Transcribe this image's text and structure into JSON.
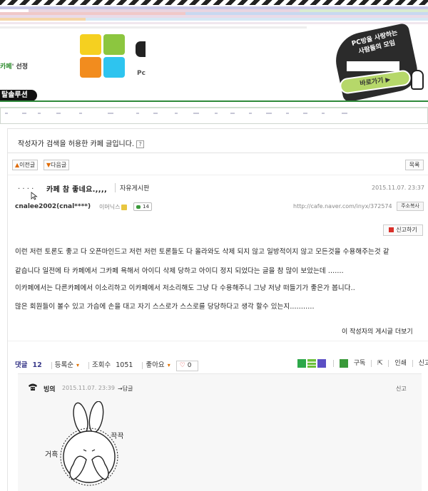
{
  "banner": {
    "brand_suffix": "카페",
    "brand_tail": "' 선정",
    "logo_fragment": "Pc",
    "promo_line1": "PC방을 사랑하는",
    "promo_line2": "사람들의 모임",
    "promo_button": "바로가기 ▶",
    "solution_label": "탈솔루션",
    "tile_colors": [
      "#f5d020",
      "#8cc63f",
      "#f28c1e",
      "#2ec4ef"
    ]
  },
  "article": {
    "notice": "작성자가 검색을 허용한 카페 글입니다.",
    "help_label": "?",
    "prev_label": "이전글",
    "next_label": "다음글",
    "list_label": "목록",
    "title_prefix": ". . . .",
    "title": "카페 참 좋네요.,,,,",
    "board": "자유게시판",
    "date": "2015.11.07. 23:37",
    "author": "cnalee2002(cnal****)",
    "grade": "이머닉스",
    "comment_badge": "14",
    "url": "http://cafe.naver.com/inyx/372574",
    "copy_label": "주소복사",
    "report_label": "신고하기",
    "paragraphs": [
      "이런 저런 토론도 좋고 다 오픈마인드고 저런 저런 토론들도 다 올라와도 삭제 되지 않고 일방적이지 않고 모든것을 수용해주는것 같",
      "같습니다 일전에 타 카페에서 그카페 욕해서 아이디 삭제 당하고 아이디 정지 되었다는 글을 참 많이 보았는데 .......",
      "이카페에서는 다른카페에서 이소리하고 이카페에서 저소리해도 그냥 다 수용해주니  그냥 저냥 떠들기가 좋은가 봅니다..",
      "많은 회원들이 볼수 있고 가슴에 손을 대고 자기 스스로가 스스로를 당당하다고 생각 할수 있는지..........."
    ],
    "more_posts": "이 작성자의 게시글 더보기"
  },
  "toolbar": {
    "comments_label": "댓글",
    "comments_count": "12",
    "sort_label": "등록순",
    "views_label": "조회수",
    "views_count": "1051",
    "like_label": "좋아요",
    "like_count": "0",
    "subscribe": "구독",
    "print": "인쇄",
    "report": "신고"
  },
  "comment": {
    "author": "빙의",
    "date": "2015.11.07. 23:39",
    "reply": "답글",
    "report": "신고",
    "sticker_text_left": "거흑",
    "sticker_text_right": "끅끅"
  }
}
